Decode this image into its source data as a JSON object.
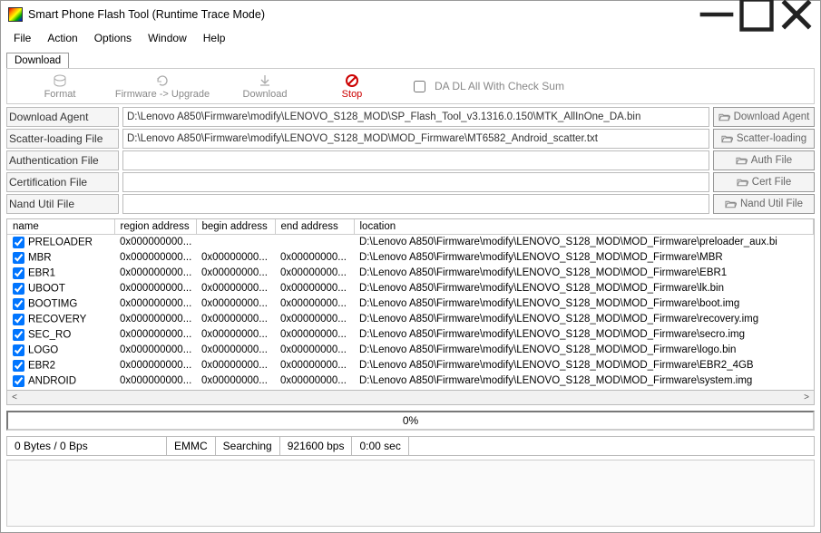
{
  "title": "Smart Phone Flash Tool (Runtime Trace Mode)",
  "menu": {
    "file": "File",
    "action": "Action",
    "options": "Options",
    "window": "Window",
    "help": "Help"
  },
  "tabs": {
    "download": "Download"
  },
  "toolbar": {
    "format": "Format",
    "upgrade": "Firmware -> Upgrade",
    "download": "Download",
    "stop": "Stop",
    "checksum": "DA DL All With Check Sum"
  },
  "labels": {
    "da": "Download Agent",
    "scatter": "Scatter-loading File",
    "auth": "Authentication File",
    "cert": "Certification File",
    "nand": "Nand Util File"
  },
  "values": {
    "da": "D:\\Lenovo A850\\Firmware\\modify\\LENOVO_S128_MOD\\SP_Flash_Tool_v3.1316.0.150\\MTK_AllInOne_DA.bin",
    "scatter": "D:\\Lenovo A850\\Firmware\\modify\\LENOVO_S128_MOD\\MOD_Firmware\\MT6582_Android_scatter.txt",
    "auth": "",
    "cert": "",
    "nand": ""
  },
  "buttons": {
    "da": "Download Agent",
    "scatter": "Scatter-loading",
    "auth": "Auth File",
    "cert": "Cert File",
    "nand": "Nand Util File"
  },
  "columns": {
    "name": "name",
    "region": "region address",
    "begin": "begin address",
    "end": "end address",
    "location": "location"
  },
  "rows": [
    {
      "name": "PRELOADER",
      "ra": "0x000000000...",
      "ba": "",
      "ea": "",
      "loc": "D:\\Lenovo A850\\Firmware\\modify\\LENOVO_S128_MOD\\MOD_Firmware\\preloader_aux.bi"
    },
    {
      "name": "MBR",
      "ra": "0x000000000...",
      "ba": "0x00000000...",
      "ea": "0x00000000...",
      "loc": "D:\\Lenovo A850\\Firmware\\modify\\LENOVO_S128_MOD\\MOD_Firmware\\MBR"
    },
    {
      "name": "EBR1",
      "ra": "0x000000000...",
      "ba": "0x00000000...",
      "ea": "0x00000000...",
      "loc": "D:\\Lenovo A850\\Firmware\\modify\\LENOVO_S128_MOD\\MOD_Firmware\\EBR1"
    },
    {
      "name": "UBOOT",
      "ra": "0x000000000...",
      "ba": "0x00000000...",
      "ea": "0x00000000...",
      "loc": "D:\\Lenovo A850\\Firmware\\modify\\LENOVO_S128_MOD\\MOD_Firmware\\lk.bin"
    },
    {
      "name": "BOOTIMG",
      "ra": "0x000000000...",
      "ba": "0x00000000...",
      "ea": "0x00000000...",
      "loc": "D:\\Lenovo A850\\Firmware\\modify\\LENOVO_S128_MOD\\MOD_Firmware\\boot.img"
    },
    {
      "name": "RECOVERY",
      "ra": "0x000000000...",
      "ba": "0x00000000...",
      "ea": "0x00000000...",
      "loc": "D:\\Lenovo A850\\Firmware\\modify\\LENOVO_S128_MOD\\MOD_Firmware\\recovery.img"
    },
    {
      "name": "SEC_RO",
      "ra": "0x000000000...",
      "ba": "0x00000000...",
      "ea": "0x00000000...",
      "loc": "D:\\Lenovo A850\\Firmware\\modify\\LENOVO_S128_MOD\\MOD_Firmware\\secro.img"
    },
    {
      "name": "LOGO",
      "ra": "0x000000000...",
      "ba": "0x00000000...",
      "ea": "0x00000000...",
      "loc": "D:\\Lenovo A850\\Firmware\\modify\\LENOVO_S128_MOD\\MOD_Firmware\\logo.bin"
    },
    {
      "name": "EBR2",
      "ra": "0x000000000...",
      "ba": "0x00000000...",
      "ea": "0x00000000...",
      "loc": "D:\\Lenovo A850\\Firmware\\modify\\LENOVO_S128_MOD\\MOD_Firmware\\EBR2_4GB"
    },
    {
      "name": "ANDROID",
      "ra": "0x000000000...",
      "ba": "0x00000000...",
      "ea": "0x00000000...",
      "loc": "D:\\Lenovo A850\\Firmware\\modify\\LENOVO_S128_MOD\\MOD_Firmware\\system.img"
    }
  ],
  "progress": "0%",
  "status": {
    "bytes": "0 Bytes / 0 Bps",
    "storage": "EMMC",
    "state": "Searching",
    "bps": "921600 bps",
    "time": "0:00 sec"
  }
}
